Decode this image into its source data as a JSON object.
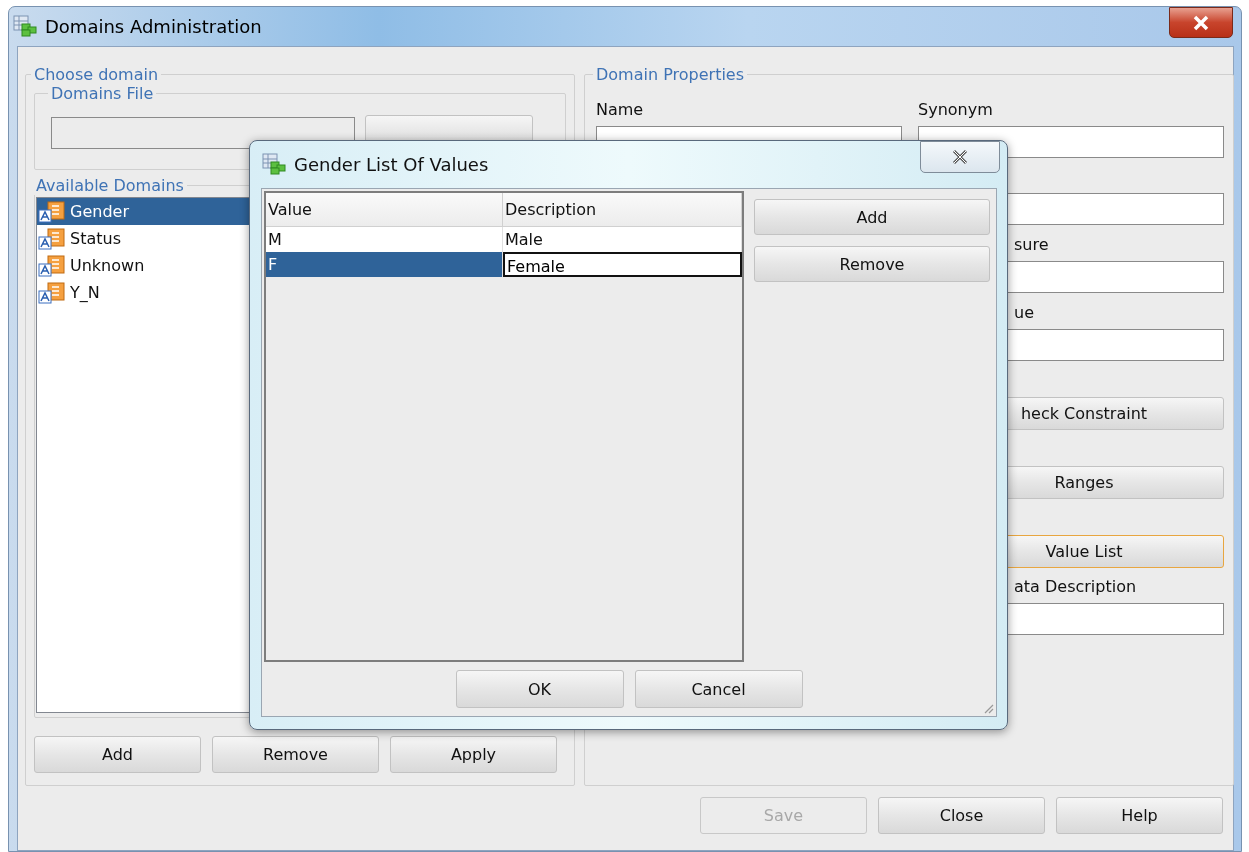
{
  "window": {
    "title": "Domains Administration"
  },
  "choose_domain": {
    "title": "Choose domain",
    "domains_file": {
      "title": "Domains File"
    },
    "available_domains": {
      "title": "Available Domains",
      "items": [
        {
          "label": "Gender",
          "selected": true
        },
        {
          "label": "Status",
          "selected": false
        },
        {
          "label": "Unknown",
          "selected": false
        },
        {
          "label": "Y_N",
          "selected": false
        }
      ]
    },
    "buttons": [
      "Add",
      "Remove",
      "Apply"
    ]
  },
  "domain_properties": {
    "title": "Domain Properties",
    "name_label": "Name",
    "synonym_label": "Synonym",
    "rows": [
      {
        "kind": "field"
      },
      {
        "kind": "label",
        "text": "sure"
      },
      {
        "kind": "field"
      },
      {
        "kind": "label",
        "text": "ue"
      },
      {
        "kind": "field"
      },
      {
        "kind": "button",
        "text": "heck Constraint",
        "focused": false
      },
      {
        "kind": "button",
        "text": "Ranges",
        "focused": false
      },
      {
        "kind": "button",
        "text": "Value List",
        "focused": true
      },
      {
        "kind": "label",
        "text": "ata Description"
      },
      {
        "kind": "field"
      }
    ]
  },
  "footer_buttons": [
    {
      "label": "Save",
      "disabled": true
    },
    {
      "label": "Close",
      "disabled": false
    },
    {
      "label": "Help",
      "disabled": false
    }
  ],
  "dialog": {
    "title": "Gender List Of Values",
    "columns": [
      "Value",
      "Description"
    ],
    "rows": [
      {
        "value": "M",
        "description": "Male",
        "selected": false,
        "editing": false
      },
      {
        "value": "F",
        "description": "Female",
        "selected": true,
        "editing": true
      }
    ],
    "side_buttons": [
      "Add",
      "Remove"
    ],
    "buttons": [
      "OK",
      "Cancel"
    ]
  }
}
